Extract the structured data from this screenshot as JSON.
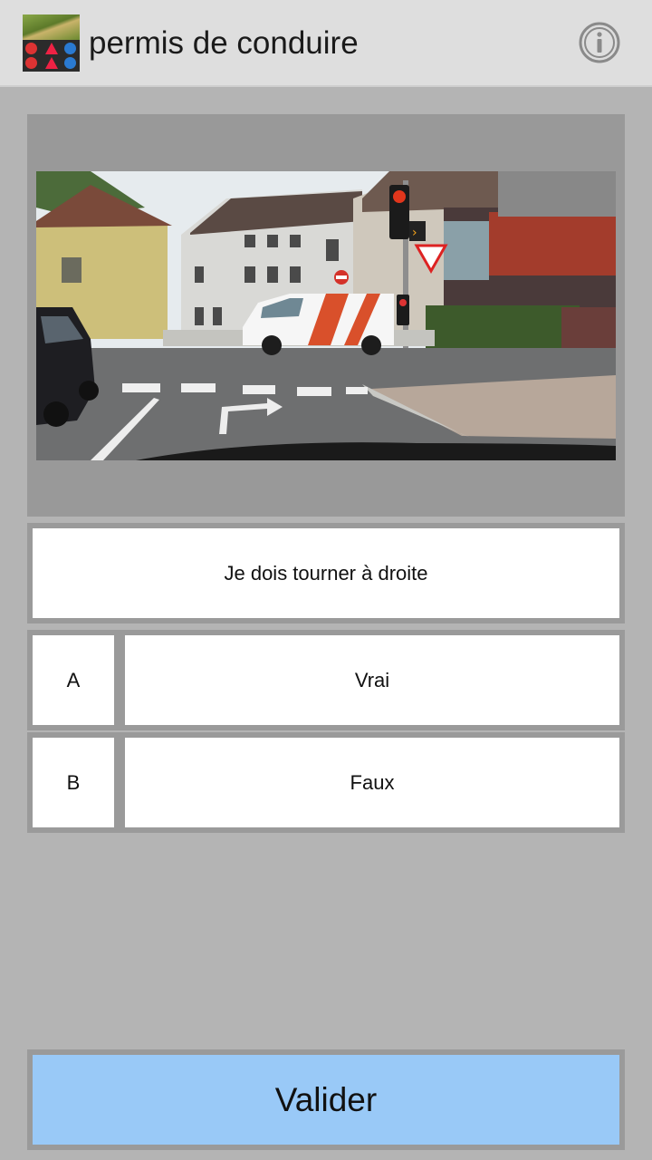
{
  "app": {
    "title": "permis de conduire",
    "logo_icon": "road-signs-logo-icon",
    "info_icon": "info-circle-icon"
  },
  "question": {
    "image_description_icon": "intersection-photo",
    "text": "Je dois tourner à droite"
  },
  "answers": [
    {
      "letter": "A",
      "label": "Vrai"
    },
    {
      "letter": "B",
      "label": "Faux"
    }
  ],
  "actions": {
    "validate_label": "Valider"
  },
  "colors": {
    "appbar": "#dedede",
    "background": "#b4b4b4",
    "card": "#999999",
    "validate": "#99c9f7"
  }
}
